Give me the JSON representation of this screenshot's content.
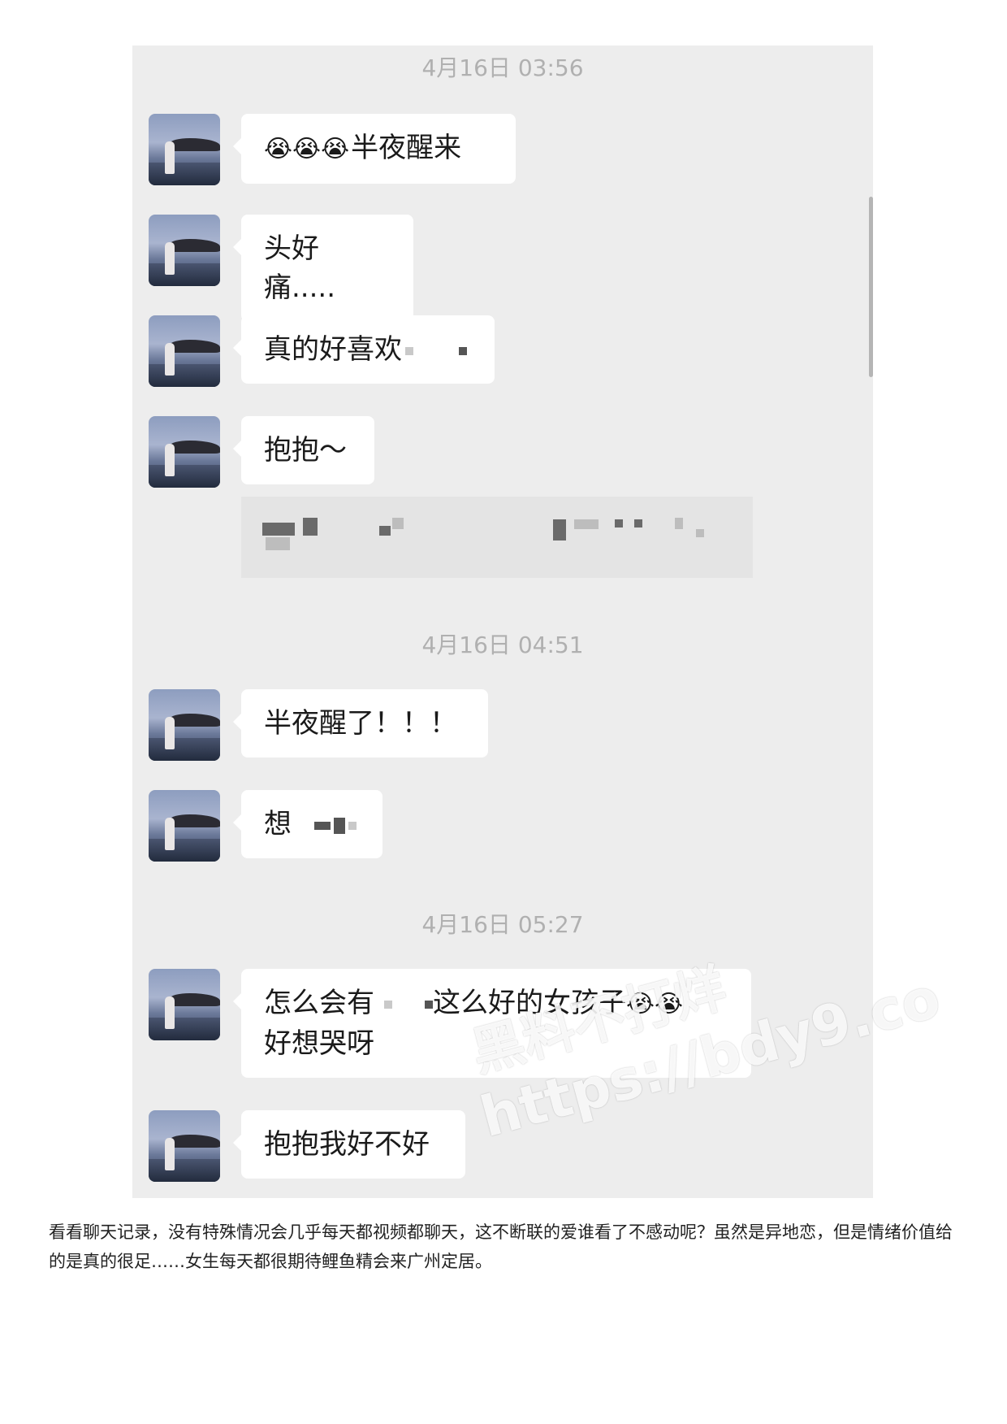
{
  "chat": {
    "timestamps": [
      "4月16日 03:56",
      "4月16日 04:51",
      "4月16日 05:27"
    ],
    "messages": [
      {
        "emoji": "😭😭😭",
        "text": "半夜醒来"
      },
      {
        "text": "头好痛....."
      },
      {
        "text": "真的好喜欢"
      },
      {
        "text": "抱抱～"
      },
      {
        "text": "半夜醒了！！！"
      },
      {
        "text": "想"
      },
      {
        "text_a": "怎么会有",
        "text_b": "这么好的女孩子",
        "emoji": "😭😭",
        "text_c": "好想哭呀"
      },
      {
        "text": "抱抱我好不好"
      }
    ]
  },
  "caption": "看看聊天记录，没有特殊情况会几乎每天都视频都聊天，这不断联的爱谁看了不感动呢？虽然是异地恋，但是情绪价值给的是真的很足……女生每天都很期待鲤鱼精会来广州定居。",
  "watermark": {
    "line1": "黑料不打烊",
    "line2": "https://bdy9.co"
  }
}
